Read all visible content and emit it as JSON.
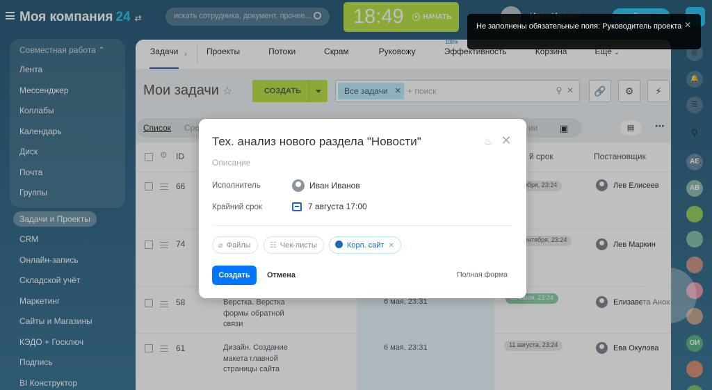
{
  "header": {
    "company_name": "Моя компания",
    "company_num": "24",
    "search_placeholder": "искать сотрудника, документ, прочее...",
    "clock_time": "18:49",
    "start_label": "НАЧАТЬ",
    "user_name": "Иван Иванов",
    "demo_label": "Демо"
  },
  "sidebar": {
    "section": "Совместная работа",
    "items": [
      {
        "label": "Лента"
      },
      {
        "label": "Мессенджер"
      },
      {
        "label": "Коллабы"
      },
      {
        "label": "Календарь"
      },
      {
        "label": "Диск"
      },
      {
        "label": "Почта"
      },
      {
        "label": "Группы"
      }
    ],
    "active_item": "Задачи и Проекты",
    "lower_items": [
      {
        "label": "CRM"
      },
      {
        "label": "Онлайн-запись"
      },
      {
        "label": "Складской учёт"
      },
      {
        "label": "Маркетинг"
      },
      {
        "label": "Сайты и Магазины"
      },
      {
        "label": "КЭДО + Госключ"
      },
      {
        "label": "Подпись"
      },
      {
        "label": "BI Конструктор"
      }
    ]
  },
  "tabs": [
    "Задачи",
    "Проекты",
    "Потоки",
    "Скрам",
    "Руковожу",
    "Эффективность",
    "Корзина",
    "Еще"
  ],
  "tab_badge": "100%",
  "page": {
    "title": "Мои задачи",
    "create_label": "СОЗДАТЬ",
    "filter_chip": "Все задачи",
    "filter_placeholder": "+ поиск",
    "view_list": "Список",
    "view_partial": "Сро",
    "view_right_partial": "ии"
  },
  "table": {
    "headers": {
      "id": "ID",
      "deadline": "й срок",
      "creator": "Постановщик"
    },
    "rows": [
      {
        "id": "66",
        "task": "",
        "date": "",
        "deadline": "ября, 23:24",
        "creator": "Лев Елисеев",
        "green": false
      },
      {
        "id": "74",
        "task": "",
        "date": "",
        "deadline": "ентября, 23:24",
        "creator": "Лев Маркин",
        "green": false
      },
      {
        "id": "58",
        "task": "Верстка. Верстка формы обратной связи",
        "date": "6 мая, 23:31",
        "deadline": "31 июля, 23:24",
        "creator": "Елизавета Анох",
        "green": true
      },
      {
        "id": "61",
        "task": "Дизайн. Создание макета главной страницы сайта",
        "date": "6 мая, 23:31",
        "deadline": "11 августа, 23:24",
        "creator": "Ева Окулова",
        "green": false
      }
    ]
  },
  "rightbar": {
    "initials": [
      "AE",
      "AB",
      "ОИ"
    ]
  },
  "popup": {
    "title": "Тех. анализ нового раздела \"Новости\"",
    "description_placeholder": "Описание",
    "assignee_label": "Исполнитель",
    "assignee_name": "Иван Иванов",
    "deadline_label": "Крайний срок",
    "deadline_value": "7 августа 17:00",
    "files_label": "Файлы",
    "checklists_label": "Чек-листы",
    "project_label": "Корп. сайт",
    "create_button": "Создать",
    "cancel_button": "Отмена",
    "full_form": "Полная форма"
  },
  "toast": {
    "message": "Не заполнены обязательные поля: Руководитель проекта"
  },
  "colors": {
    "accent_green": "#bbe048",
    "accent_blue": "#0075ff",
    "link_blue": "#2067b0"
  }
}
